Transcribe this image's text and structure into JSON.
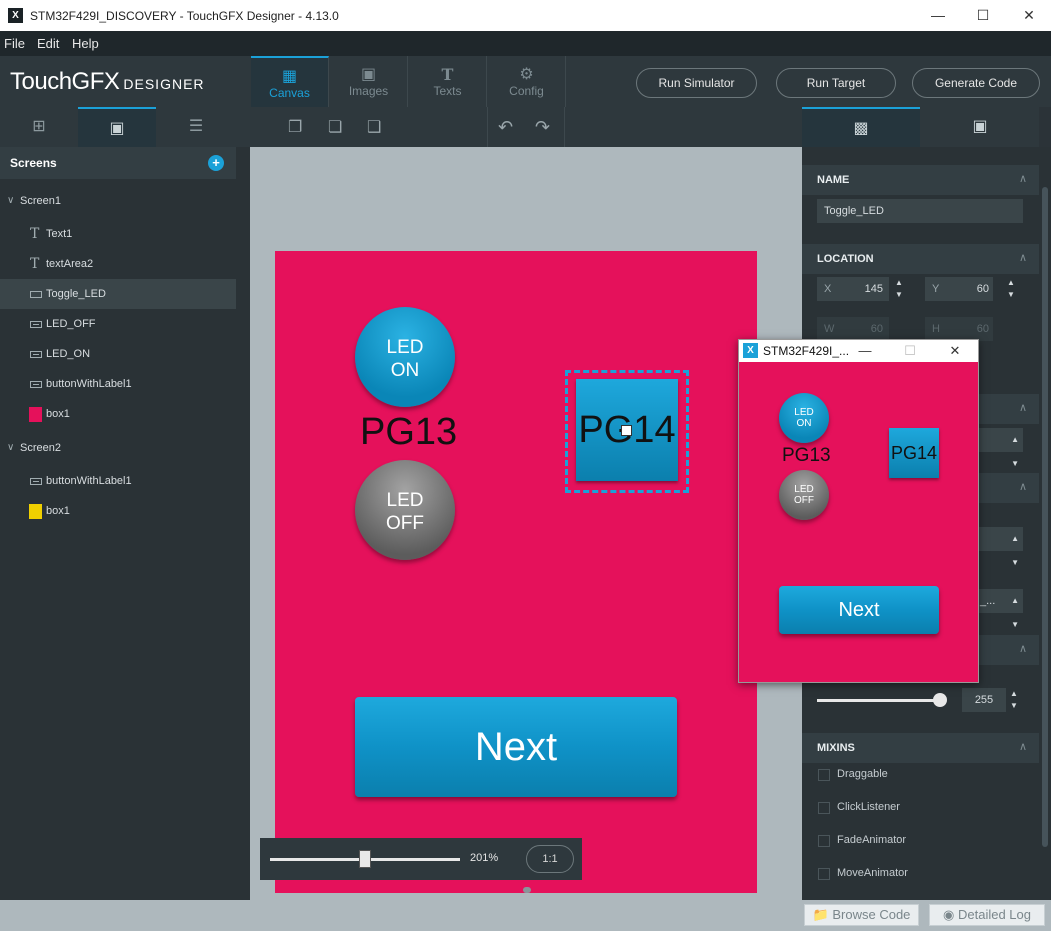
{
  "window": {
    "title": "STM32F429I_DISCOVERY - TouchGFX Designer - 4.13.0",
    "app_icon": "X",
    "min_icon": "minimize-icon",
    "max_icon": "maximize-icon",
    "close_icon": "close-icon"
  },
  "menu": [
    "File",
    "Edit",
    "Help"
  ],
  "logo": {
    "main": "TouchGFX",
    "sub": "DESIGNER"
  },
  "tabs": [
    {
      "label": "Canvas",
      "icon": "canvas-icon"
    },
    {
      "label": "Images",
      "icon": "images-icon"
    },
    {
      "label": "Texts",
      "icon": "texts-icon"
    },
    {
      "label": "Config",
      "icon": "config-icon"
    }
  ],
  "actions": {
    "run_simulator": "Run Simulator",
    "run_target": "Run Target",
    "generate_code": "Generate Code"
  },
  "colors": {
    "accent": "#1ba1d8",
    "screen_bg": "#e5115b",
    "box1_screen1": "#e5115b",
    "box1_screen2": "#f0d000"
  },
  "left_panel": {
    "header": "Screens",
    "screens": [
      {
        "name": "Screen1",
        "children": [
          {
            "label": "Text1",
            "icon": "text-icon"
          },
          {
            "label": "textArea2",
            "icon": "text-icon"
          },
          {
            "label": "Toggle_LED",
            "icon": "toggle-icon"
          },
          {
            "label": "LED_OFF",
            "icon": "button-icon"
          },
          {
            "label": "LED_ON",
            "icon": "button-icon"
          },
          {
            "label": "buttonWithLabel1",
            "icon": "button-icon"
          },
          {
            "label": "box1",
            "icon": "box-icon"
          }
        ]
      },
      {
        "name": "Screen2",
        "children": [
          {
            "label": "buttonWithLabel1",
            "icon": "button-icon"
          },
          {
            "label": "box1",
            "icon": "box-icon"
          }
        ]
      }
    ]
  },
  "canvas": {
    "led_on": [
      "LED",
      "ON"
    ],
    "led_off": [
      "LED",
      "OFF"
    ],
    "pg13": "PG13",
    "pg14": "PG14",
    "next": "Next",
    "zoom": "201%",
    "one_to_one": "1:1"
  },
  "properties": {
    "name_header": "NAME",
    "name_value": "Toggle_LED",
    "location_header": "LOCATION",
    "x_label": "X",
    "x_value": "145",
    "y_label": "Y",
    "y_value": "60",
    "w_label": "W",
    "w_value": "60",
    "h_label": "H",
    "h_value": "60",
    "alpha_value": "255",
    "truncated_value": "_...",
    "mixins_header": "MIXINS",
    "mixins": [
      {
        "label": "Draggable",
        "checked": false
      },
      {
        "label": "ClickListener",
        "checked": false
      },
      {
        "label": "FadeAnimator",
        "checked": false
      },
      {
        "label": "MoveAnimator",
        "checked": false
      }
    ]
  },
  "bottom": {
    "browse_code": "Browse Code",
    "detailed_log": "Detailed Log"
  },
  "simulator": {
    "title": "STM32F429I_...",
    "led_on": [
      "LED",
      "ON"
    ],
    "led_off": [
      "LED",
      "OFF"
    ],
    "pg13": "PG13",
    "pg14": "PG14",
    "next": "Next"
  }
}
